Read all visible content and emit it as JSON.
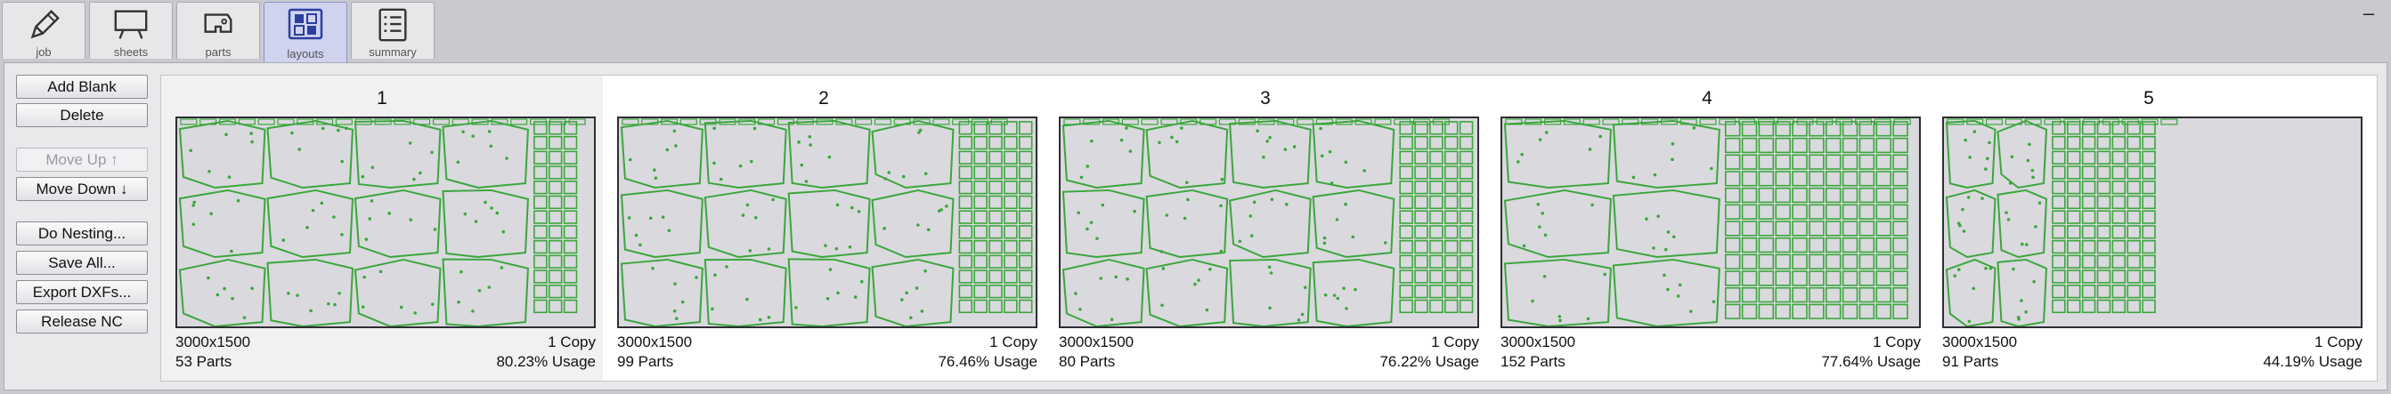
{
  "tabs": [
    {
      "label": "job",
      "icon": "pencil-icon"
    },
    {
      "label": "sheets",
      "icon": "sheet-icon"
    },
    {
      "label": "parts",
      "icon": "part-icon"
    },
    {
      "label": "layouts",
      "icon": "layouts-icon",
      "active": true
    },
    {
      "label": "summary",
      "icon": "list-icon"
    }
  ],
  "window": {
    "minimize_label": "–"
  },
  "actions": {
    "add_blank": "Add Blank",
    "delete": "Delete",
    "move_up": "Move Up ↑",
    "move_down": "Move Down ↓",
    "do_nesting": "Do Nesting...",
    "save_all": "Save All...",
    "export_dxfs": "Export DXFs...",
    "release_nc": "Release NC"
  },
  "layouts": [
    {
      "number": "1",
      "size": "3000x1500",
      "copies": "1 Copy",
      "parts": "53 Parts",
      "usage": "80.23% Usage",
      "usage_fraction": 0.8023
    },
    {
      "number": "2",
      "size": "3000x1500",
      "copies": "1 Copy",
      "parts": "99 Parts",
      "usage": "76.46% Usage",
      "usage_fraction": 0.7646
    },
    {
      "number": "3",
      "size": "3000x1500",
      "copies": "1 Copy",
      "parts": "80 Parts",
      "usage": "76.22% Usage",
      "usage_fraction": 0.7622
    },
    {
      "number": "4",
      "size": "3000x1500",
      "copies": "1 Copy",
      "parts": "152 Parts",
      "usage": "77.64% Usage",
      "usage_fraction": 0.7764
    },
    {
      "number": "5",
      "size": "3000x1500",
      "copies": "1 Copy",
      "parts": "91 Parts",
      "usage": "44.19% Usage",
      "usage_fraction": 0.4419
    }
  ],
  "colors": {
    "part_outline": "#3aa63a",
    "sheet_fill": "#d9d9de",
    "active_tab": "#cfd3ee"
  }
}
